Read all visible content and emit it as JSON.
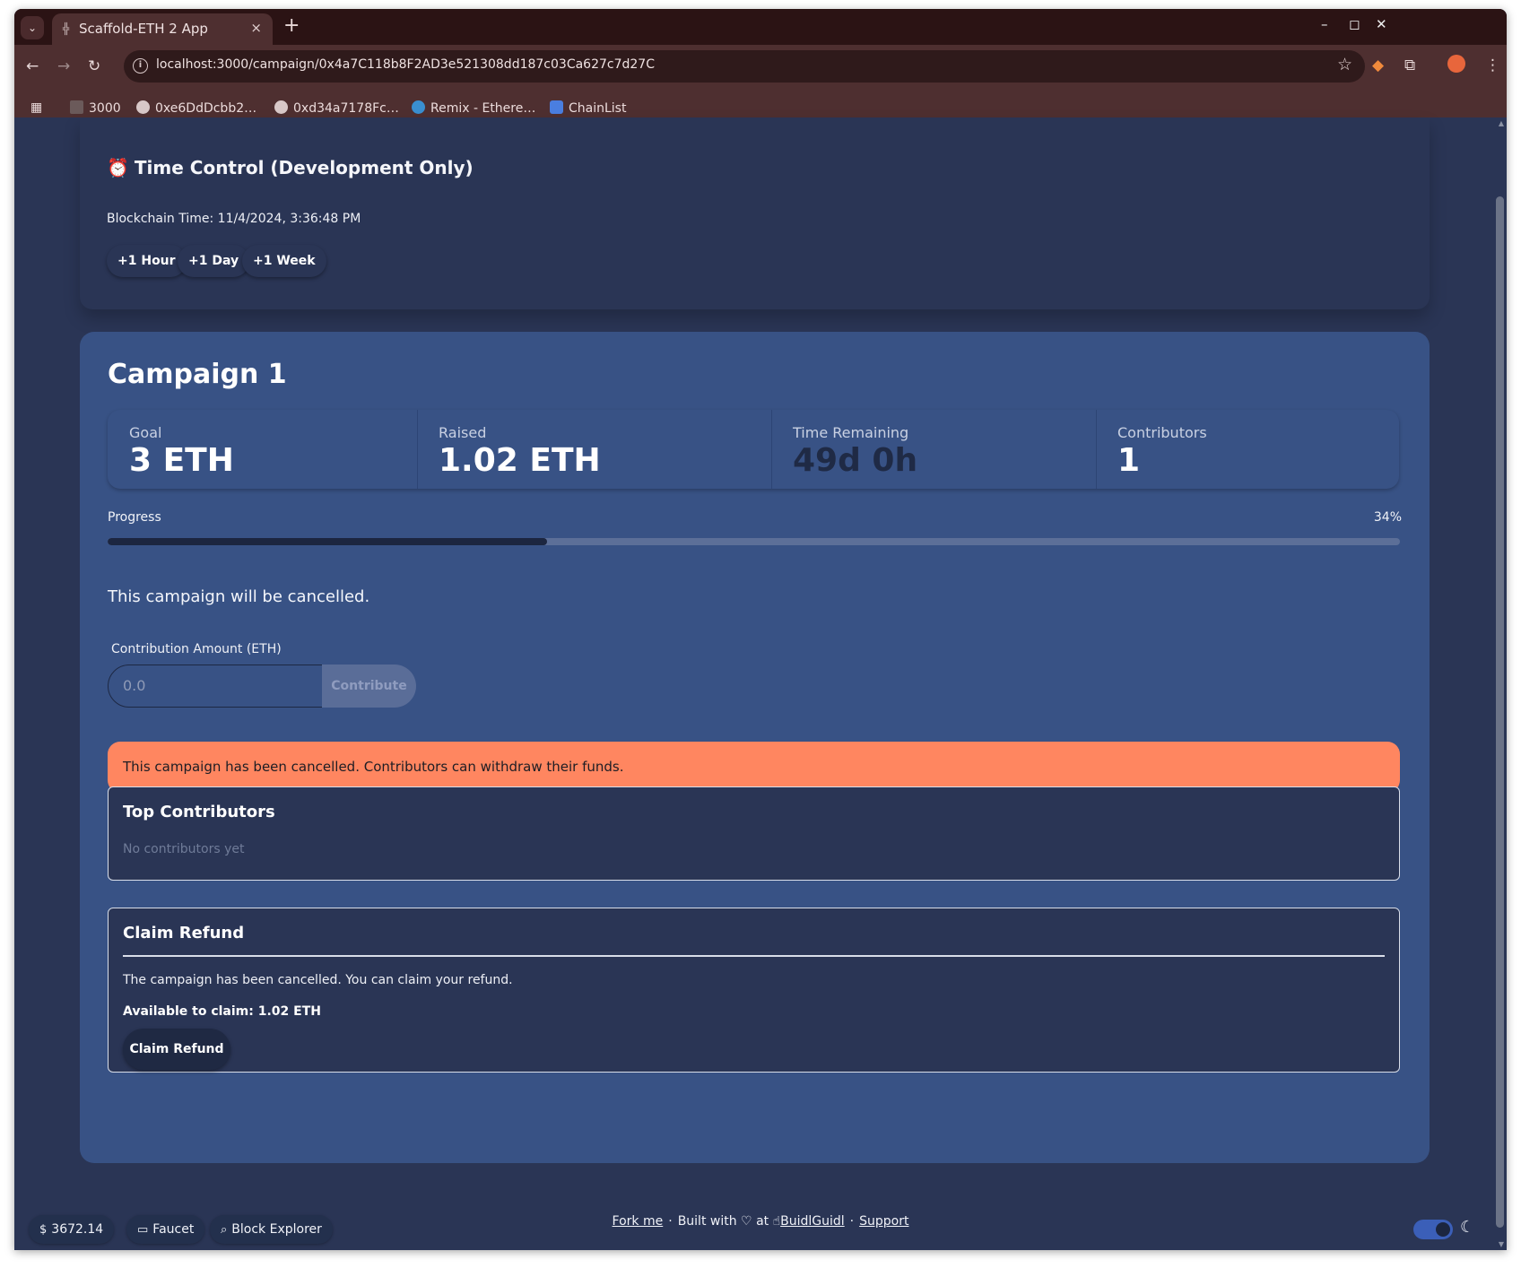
{
  "browser": {
    "tab_title": "Scaffold-ETH 2 App",
    "tab_close": "×",
    "new_tab": "+",
    "url": "localhost:3000/campaign/0x4a7C118b8F2AD3e521308dd187c03Ca627c7d27C",
    "window_controls": {
      "minimize": "–",
      "maximize": "◻",
      "close": "✕"
    },
    "bookmarks": [
      {
        "label": "3000",
        "icon": "scaffold-icon"
      },
      {
        "label": "0xe6DdDcbb2…",
        "icon": "scaffold-icon"
      },
      {
        "label": "0xd34a7178Fc…",
        "icon": "scaffold-icon"
      },
      {
        "label": "Remix - Ethere…",
        "icon": "remix-icon"
      },
      {
        "label": "ChainList",
        "icon": "chainlist-icon"
      }
    ]
  },
  "time_control": {
    "title": "Time Control (Development Only)",
    "icon": "⏰",
    "blockchain_time": "Blockchain Time: 11/4/2024, 3:36:48 PM",
    "buttons": [
      "+1 Hour",
      "+1 Day",
      "+1 Week"
    ]
  },
  "campaign": {
    "title": "Campaign 1",
    "stats": [
      {
        "label": "Goal",
        "value": "3 ETH"
      },
      {
        "label": "Raised",
        "value": "1.02 ETH"
      },
      {
        "label": "Time Remaining",
        "value": "49d 0h"
      },
      {
        "label": "Contributors",
        "value": "1"
      }
    ],
    "progress": {
      "label": "Progress",
      "percent_text": "34%",
      "fraction": 0.34
    },
    "status_note": "This campaign will be cancelled.",
    "contribution": {
      "label": "Contribution Amount (ETH)",
      "placeholder": "0.0",
      "button": "Contribute"
    },
    "alert": "This campaign has been cancelled. Contributors can withdraw their funds.",
    "top_contributors": {
      "title": "Top Contributors",
      "empty": "No contributors yet"
    },
    "refund": {
      "title": "Claim Refund",
      "text": "The campaign has been cancelled. You can claim your refund.",
      "available": "Available to claim: 1.02 ETH",
      "button": "Claim Refund"
    }
  },
  "footer": {
    "price": "3672.14",
    "faucet": "Faucet",
    "block_explorer": "Block Explorer",
    "fork_me": "Fork me",
    "built_with": "Built with",
    "at": "at",
    "buidlguidl": "BuidlGuidl",
    "support": "Support"
  },
  "colors": {
    "page_bg": "#2a3555",
    "card_bg": "#385285",
    "alert_bg": "#ff8660",
    "chrome_bg": "#4e2f30"
  }
}
